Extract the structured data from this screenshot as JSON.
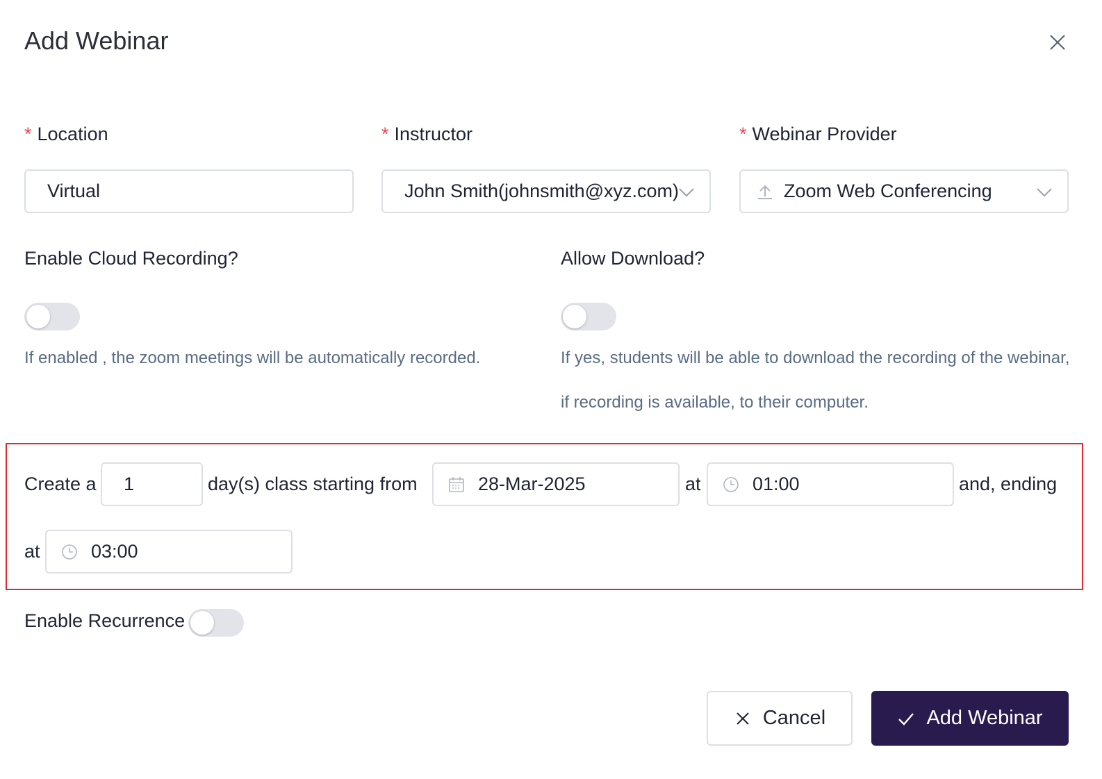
{
  "dialog": {
    "title": "Add Webinar"
  },
  "fields": {
    "location": {
      "label": "Location",
      "required_mark": "*",
      "value": "Virtual"
    },
    "instructor": {
      "label": "Instructor",
      "required_mark": "*",
      "value": "John Smith(johnsmith@xyz.com)"
    },
    "provider": {
      "label": "Webinar Provider",
      "required_mark": "*",
      "value": "Zoom Web Conferencing"
    }
  },
  "cloud_recording": {
    "label": "Enable Cloud Recording?",
    "enabled": false,
    "help": "If enabled , the zoom meetings will be automatically recorded."
  },
  "allow_download": {
    "label": "Allow Download?",
    "enabled": false,
    "help": "If yes, students will be able to download the recording of the webinar, if recording is available, to their computer."
  },
  "schedule": {
    "prefix": "Create a",
    "days": "1",
    "days_suffix": "day(s) class starting from",
    "start_date": "28-Mar-2025",
    "at1": "at",
    "start_time": "01:00",
    "ending_text": "and, ending",
    "at2": "at",
    "end_time": "03:00"
  },
  "recurrence": {
    "label": "Enable Recurrence",
    "enabled": false
  },
  "actions": {
    "cancel_label": "Cancel",
    "submit_label": "Add Webinar"
  },
  "colors": {
    "primary": "#2a1b4f",
    "required": "#e5484d",
    "highlight_border": "#e0282e"
  }
}
